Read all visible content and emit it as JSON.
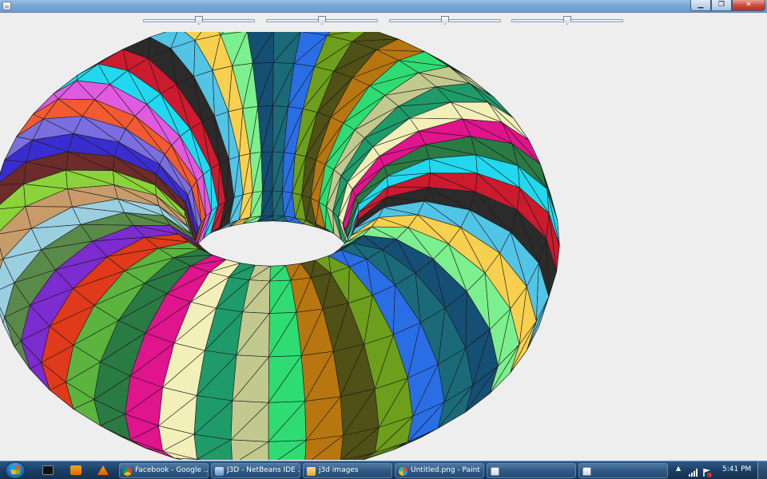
{
  "window": {
    "app_icon": "java-cup-icon",
    "buttons": {
      "minimize": "▁",
      "maximize": "❐",
      "close": "✕"
    }
  },
  "sliders": [
    {
      "name": "slider-1",
      "value_fraction": 0.5
    },
    {
      "name": "slider-2",
      "value_fraction": 0.5
    },
    {
      "name": "slider-3",
      "value_fraction": 0.5
    },
    {
      "name": "slider-4",
      "value_fraction": 0.5
    }
  ],
  "scene": {
    "object": "torus",
    "major_segments": 48,
    "minor_segments": 14,
    "background": "#eeeeee",
    "edge_color": "#1a1a1a",
    "palette": [
      "#2a7a44",
      "#e0148c",
      "#f2f0b8",
      "#1f9b6a",
      "#c2c98e",
      "#2edc73",
      "#b87610",
      "#4f5116",
      "#6d9e1c",
      "#2a6ee6",
      "#1a6a7a",
      "#154f73",
      "#7cef8e",
      "#f8d050",
      "#52c4e6",
      "#2b2b2b",
      "#cc1a2e",
      "#22d8ee",
      "#e05be0",
      "#f25a32",
      "#7b6ee0",
      "#3a2dcf",
      "#6d2b2b",
      "#8bd33b",
      "#c89c6a",
      "#9acfe0",
      "#5a8a4a",
      "#7c2ccf",
      "#e03a1a",
      "#5bb43e"
    ]
  },
  "taskbar": {
    "tasks": [
      {
        "label": "Facebook - Google ...",
        "icon": "chrome-icon",
        "color": "#e8b420"
      },
      {
        "label": "J3D - NetBeans IDE ...",
        "icon": "netbeans-icon",
        "color": "#9bc3ea"
      },
      {
        "label": "j3d images",
        "icon": "folder-icon",
        "color": "#f2cf5b"
      },
      {
        "label": "Untitled.png - Paint",
        "icon": "paint-icon",
        "color": "#d8d8d8"
      },
      {
        "label": "",
        "icon": "java-icon",
        "color": "#cfd8e6"
      },
      {
        "label": "",
        "icon": "java-icon",
        "color": "#cfd8e6"
      }
    ],
    "tray_arrow": "▲",
    "clock": "5:41 PM"
  }
}
